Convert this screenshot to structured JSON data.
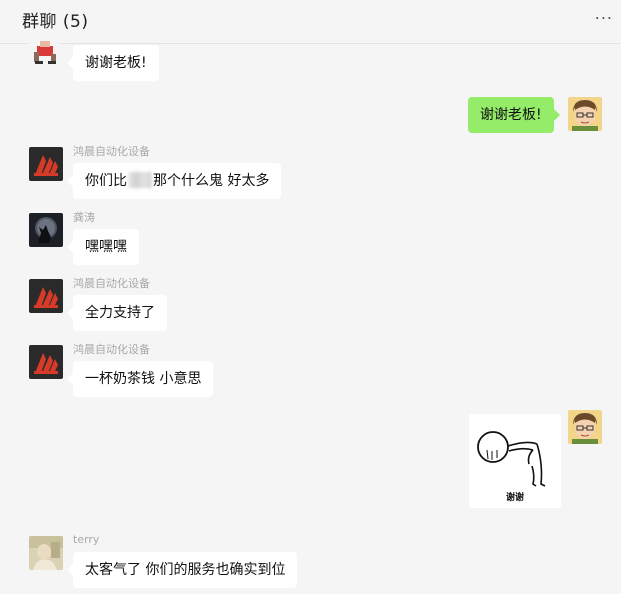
{
  "header": {
    "title": "群聊 (5)",
    "more_label": "..."
  },
  "messages": [
    {
      "id": "m1",
      "side": "left",
      "avatar_icon": "red-figure-avatar-icon",
      "sender": "",
      "text": "谢谢老板!"
    },
    {
      "id": "m2",
      "side": "right",
      "avatar_icon": "cartoon-boy-avatar-icon",
      "text": "谢谢老板!"
    },
    {
      "id": "m3",
      "side": "left",
      "avatar_icon": "red-logo-avatar-icon",
      "sender": "鸿晨自动化设备",
      "text_before": "你们比",
      "text_after": "那个什么鬼  好太多"
    },
    {
      "id": "m4",
      "side": "left",
      "avatar_icon": "wolf-moon-avatar-icon",
      "sender": "龚涛",
      "text": "嘿嘿嘿"
    },
    {
      "id": "m5",
      "side": "left",
      "avatar_icon": "red-logo-avatar-icon",
      "sender": "鸿晨自动化设备",
      "text": "全力支持了"
    },
    {
      "id": "m6",
      "side": "left",
      "avatar_icon": "red-logo-avatar-icon",
      "sender": "鸿晨自动化设备",
      "text": "一杯奶茶钱  小意思"
    },
    {
      "id": "m7",
      "side": "right",
      "avatar_icon": "cartoon-boy-avatar-icon",
      "sticker_icon": "bowing-stickman-icon",
      "sticker_caption": "谢谢"
    },
    {
      "id": "m8",
      "side": "left",
      "avatar_icon": "photo-avatar-icon",
      "sender": "terry",
      "text": "太客气了  你们的服务也确实到位"
    }
  ],
  "colors": {
    "background": "#f5f5f5",
    "incoming_bubble": "#ffffff",
    "outgoing_bubble": "#95ec69",
    "sender_name": "#a9a9a9",
    "logo_red": "#d63b2a"
  }
}
